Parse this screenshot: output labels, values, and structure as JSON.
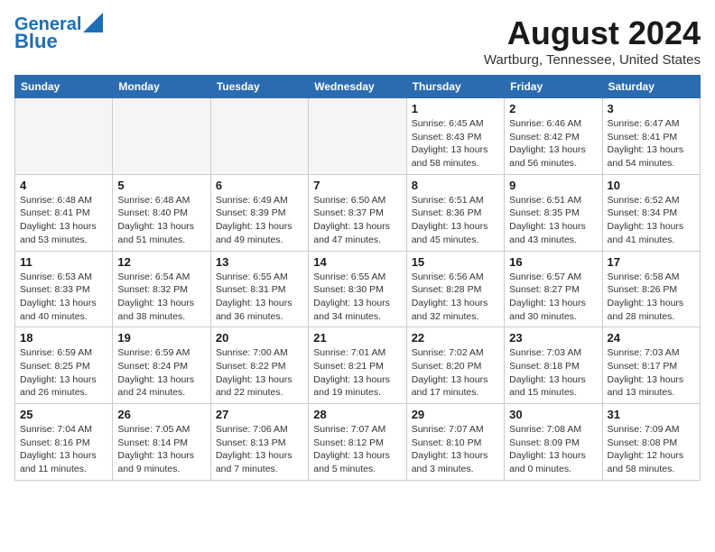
{
  "header": {
    "logo_line1": "General",
    "logo_line2": "Blue",
    "title": "August 2024",
    "location": "Wartburg, Tennessee, United States"
  },
  "weekdays": [
    "Sunday",
    "Monday",
    "Tuesday",
    "Wednesday",
    "Thursday",
    "Friday",
    "Saturday"
  ],
  "weeks": [
    [
      {
        "day": "",
        "info": ""
      },
      {
        "day": "",
        "info": ""
      },
      {
        "day": "",
        "info": ""
      },
      {
        "day": "",
        "info": ""
      },
      {
        "day": "1",
        "info": "Sunrise: 6:45 AM\nSunset: 8:43 PM\nDaylight: 13 hours\nand 58 minutes."
      },
      {
        "day": "2",
        "info": "Sunrise: 6:46 AM\nSunset: 8:42 PM\nDaylight: 13 hours\nand 56 minutes."
      },
      {
        "day": "3",
        "info": "Sunrise: 6:47 AM\nSunset: 8:41 PM\nDaylight: 13 hours\nand 54 minutes."
      }
    ],
    [
      {
        "day": "4",
        "info": "Sunrise: 6:48 AM\nSunset: 8:41 PM\nDaylight: 13 hours\nand 53 minutes."
      },
      {
        "day": "5",
        "info": "Sunrise: 6:48 AM\nSunset: 8:40 PM\nDaylight: 13 hours\nand 51 minutes."
      },
      {
        "day": "6",
        "info": "Sunrise: 6:49 AM\nSunset: 8:39 PM\nDaylight: 13 hours\nand 49 minutes."
      },
      {
        "day": "7",
        "info": "Sunrise: 6:50 AM\nSunset: 8:37 PM\nDaylight: 13 hours\nand 47 minutes."
      },
      {
        "day": "8",
        "info": "Sunrise: 6:51 AM\nSunset: 8:36 PM\nDaylight: 13 hours\nand 45 minutes."
      },
      {
        "day": "9",
        "info": "Sunrise: 6:51 AM\nSunset: 8:35 PM\nDaylight: 13 hours\nand 43 minutes."
      },
      {
        "day": "10",
        "info": "Sunrise: 6:52 AM\nSunset: 8:34 PM\nDaylight: 13 hours\nand 41 minutes."
      }
    ],
    [
      {
        "day": "11",
        "info": "Sunrise: 6:53 AM\nSunset: 8:33 PM\nDaylight: 13 hours\nand 40 minutes."
      },
      {
        "day": "12",
        "info": "Sunrise: 6:54 AM\nSunset: 8:32 PM\nDaylight: 13 hours\nand 38 minutes."
      },
      {
        "day": "13",
        "info": "Sunrise: 6:55 AM\nSunset: 8:31 PM\nDaylight: 13 hours\nand 36 minutes."
      },
      {
        "day": "14",
        "info": "Sunrise: 6:55 AM\nSunset: 8:30 PM\nDaylight: 13 hours\nand 34 minutes."
      },
      {
        "day": "15",
        "info": "Sunrise: 6:56 AM\nSunset: 8:28 PM\nDaylight: 13 hours\nand 32 minutes."
      },
      {
        "day": "16",
        "info": "Sunrise: 6:57 AM\nSunset: 8:27 PM\nDaylight: 13 hours\nand 30 minutes."
      },
      {
        "day": "17",
        "info": "Sunrise: 6:58 AM\nSunset: 8:26 PM\nDaylight: 13 hours\nand 28 minutes."
      }
    ],
    [
      {
        "day": "18",
        "info": "Sunrise: 6:59 AM\nSunset: 8:25 PM\nDaylight: 13 hours\nand 26 minutes."
      },
      {
        "day": "19",
        "info": "Sunrise: 6:59 AM\nSunset: 8:24 PM\nDaylight: 13 hours\nand 24 minutes."
      },
      {
        "day": "20",
        "info": "Sunrise: 7:00 AM\nSunset: 8:22 PM\nDaylight: 13 hours\nand 22 minutes."
      },
      {
        "day": "21",
        "info": "Sunrise: 7:01 AM\nSunset: 8:21 PM\nDaylight: 13 hours\nand 19 minutes."
      },
      {
        "day": "22",
        "info": "Sunrise: 7:02 AM\nSunset: 8:20 PM\nDaylight: 13 hours\nand 17 minutes."
      },
      {
        "day": "23",
        "info": "Sunrise: 7:03 AM\nSunset: 8:18 PM\nDaylight: 13 hours\nand 15 minutes."
      },
      {
        "day": "24",
        "info": "Sunrise: 7:03 AM\nSunset: 8:17 PM\nDaylight: 13 hours\nand 13 minutes."
      }
    ],
    [
      {
        "day": "25",
        "info": "Sunrise: 7:04 AM\nSunset: 8:16 PM\nDaylight: 13 hours\nand 11 minutes."
      },
      {
        "day": "26",
        "info": "Sunrise: 7:05 AM\nSunset: 8:14 PM\nDaylight: 13 hours\nand 9 minutes."
      },
      {
        "day": "27",
        "info": "Sunrise: 7:06 AM\nSunset: 8:13 PM\nDaylight: 13 hours\nand 7 minutes."
      },
      {
        "day": "28",
        "info": "Sunrise: 7:07 AM\nSunset: 8:12 PM\nDaylight: 13 hours\nand 5 minutes."
      },
      {
        "day": "29",
        "info": "Sunrise: 7:07 AM\nSunset: 8:10 PM\nDaylight: 13 hours\nand 3 minutes."
      },
      {
        "day": "30",
        "info": "Sunrise: 7:08 AM\nSunset: 8:09 PM\nDaylight: 13 hours\nand 0 minutes."
      },
      {
        "day": "31",
        "info": "Sunrise: 7:09 AM\nSunset: 8:08 PM\nDaylight: 12 hours\nand 58 minutes."
      }
    ]
  ]
}
